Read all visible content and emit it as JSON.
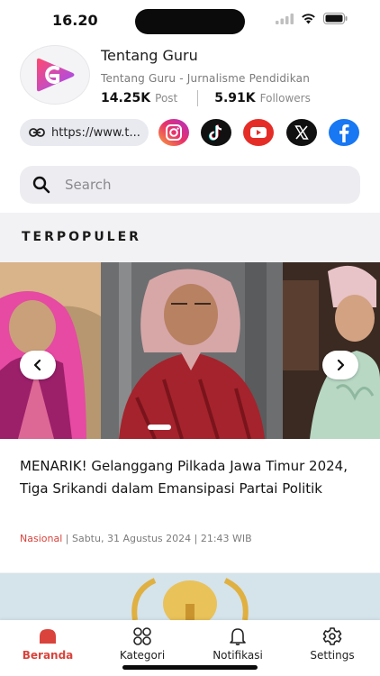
{
  "status_bar": {
    "time": "16.20"
  },
  "profile": {
    "name": "Tentang Guru",
    "subtitle": "Tentang Guru - Jurnalisme Pendidikan",
    "post_count": "14.25K",
    "post_label": "Post",
    "followers_count": "5.91K",
    "followers_label": "Followers"
  },
  "social": {
    "link_text": "https://www.t...",
    "icons": [
      "instagram-icon",
      "tiktok-icon",
      "youtube-icon",
      "x-icon",
      "facebook-icon"
    ],
    "colors": {
      "instagram": "#e1306c",
      "tiktok": "#111111",
      "youtube": "#e52d27",
      "x": "#111111",
      "facebook": "#1877f2"
    }
  },
  "search": {
    "placeholder": "Search",
    "value": ""
  },
  "section": {
    "title": "TERPOPULER"
  },
  "featured_article": {
    "title": "MENARIK! Gelanggang Pilkada Jawa Timur 2024, Tiga Srikandi dalam Emansipasi Partai Politik",
    "category": "Nasional",
    "meta": " | Sabtu, 31 Agustus 2024 | 21:43 WIB"
  },
  "bottom_nav": {
    "items": [
      {
        "label": "Beranda",
        "icon": "home-icon",
        "active": true
      },
      {
        "label": "Kategori",
        "icon": "grid-icon",
        "active": false
      },
      {
        "label": "Notifikasi",
        "icon": "bell-icon",
        "active": false
      },
      {
        "label": "Settings",
        "icon": "gear-icon",
        "active": false
      }
    ]
  },
  "colors": {
    "accent": "#d9433c",
    "brand_gradient": [
      "#ff3d78",
      "#8a4bff"
    ]
  }
}
